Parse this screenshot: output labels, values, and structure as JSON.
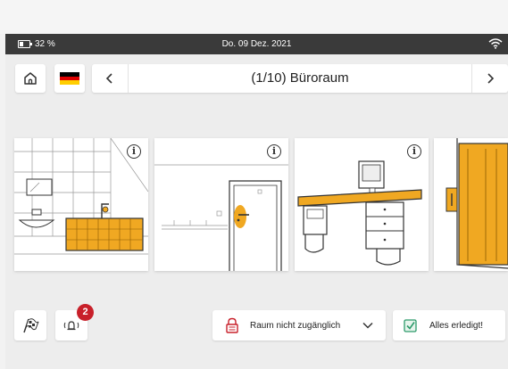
{
  "status": {
    "battery": "32 %",
    "datetime": "Do. 09 Dez. 2021",
    "icons": [
      "battery-icon",
      "wifi-icon"
    ]
  },
  "header": {
    "home_icon": "home-icon",
    "language_flag": "flag-germany-icon",
    "room_title": "(1/10) Büroraum",
    "prev_icon": "chevron-left-icon",
    "next_icon": "chevron-right-icon"
  },
  "rooms": [
    {
      "name": "bathroom",
      "icon": "info-icon"
    },
    {
      "name": "door",
      "icon": "info-icon"
    },
    {
      "name": "desk",
      "icon": "info-icon"
    },
    {
      "name": "cabinet"
    }
  ],
  "footer": {
    "finish_flag_icon": "checkered-flag-icon",
    "alarm_icon": "alarm-bell-icon",
    "notification_count": "2",
    "room_inaccessible_label": "Raum nicht zugänglich",
    "all_done_label": "Alles erledigt!"
  },
  "colors": {
    "accent": "#f0a822",
    "alert": "#c8202a",
    "status_bar": "#3a3a3a",
    "success": "#2c9a6a"
  }
}
